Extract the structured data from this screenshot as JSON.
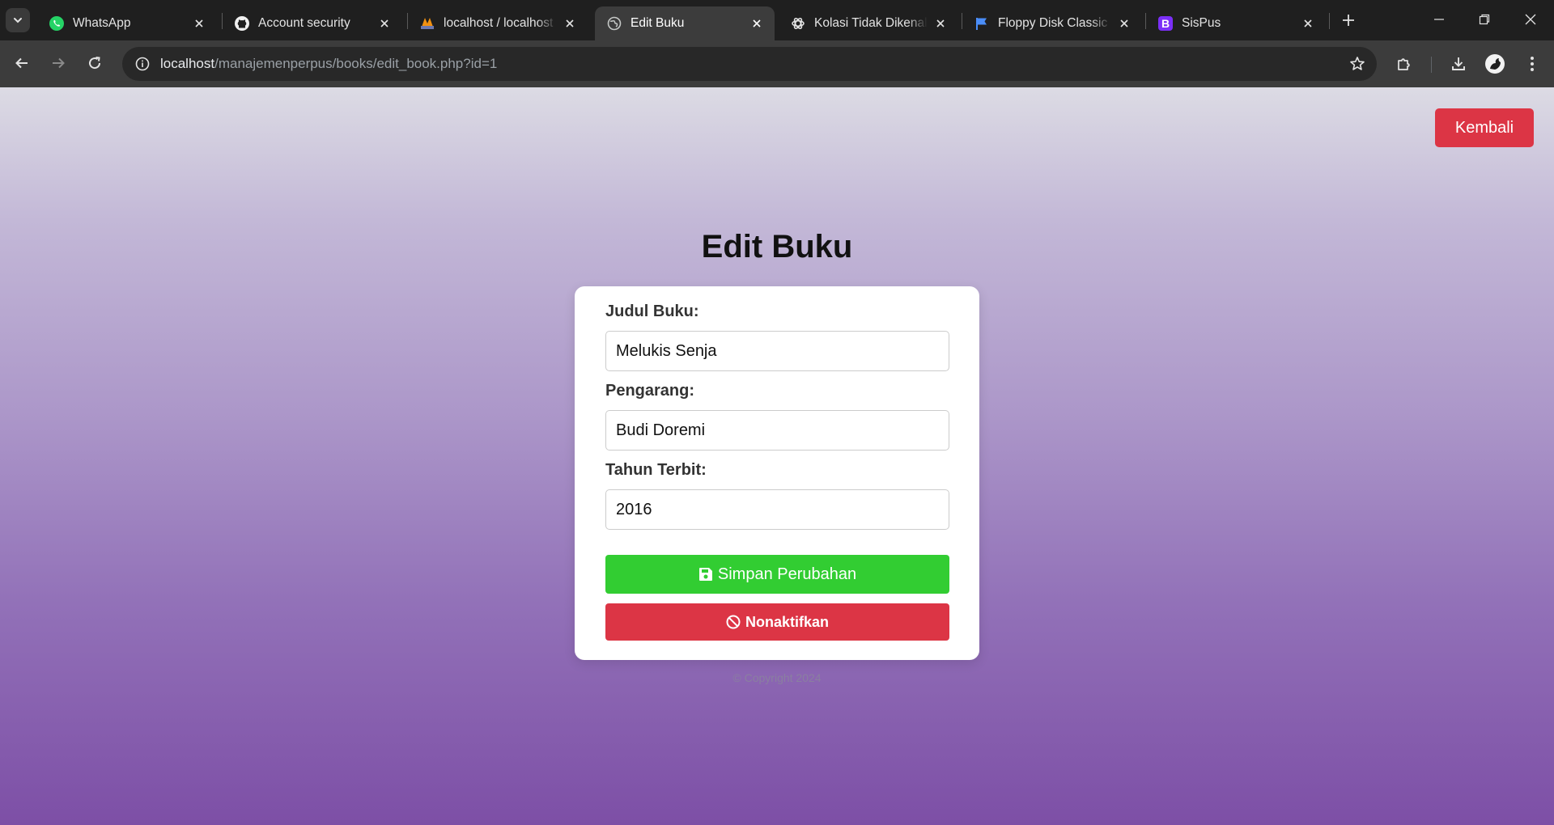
{
  "browser": {
    "tabs": [
      {
        "title": "WhatsApp",
        "icon": "whatsapp-icon",
        "active": false
      },
      {
        "title": "Account security",
        "icon": "github-icon",
        "active": false
      },
      {
        "title": "localhost / localhost / ",
        "icon": "phpmyadmin-icon",
        "active": false
      },
      {
        "title": "Edit Buku",
        "icon": "globe-icon",
        "active": true
      },
      {
        "title": "Kolasi Tidak Dikenal I",
        "icon": "openai-icon",
        "active": false
      },
      {
        "title": "Floppy Disk Classic Li",
        "icon": "flag-icon",
        "active": false
      },
      {
        "title": "SisPus",
        "icon": "bootstrap-icon",
        "active": false
      }
    ],
    "address": {
      "host": "localhost",
      "path": "/manajemenperpus/books/edit_book.php?id=1"
    }
  },
  "page": {
    "back_button": "Kembali",
    "title": "Edit Buku",
    "form": {
      "title_label": "Judul Buku:",
      "title_value": "Melukis Senja",
      "author_label": "Pengarang:",
      "author_value": "Budi Doremi",
      "year_label": "Tahun Terbit:",
      "year_value": "2016",
      "save_button": "Simpan Perubahan",
      "deactivate_button": "Nonaktifkan"
    },
    "footer": "© Copyright 2024"
  },
  "colors": {
    "danger": "#dc3545",
    "success": "#32cd32",
    "gradient_top": "#dcdbe4",
    "gradient_bottom": "#7d4fa6"
  }
}
